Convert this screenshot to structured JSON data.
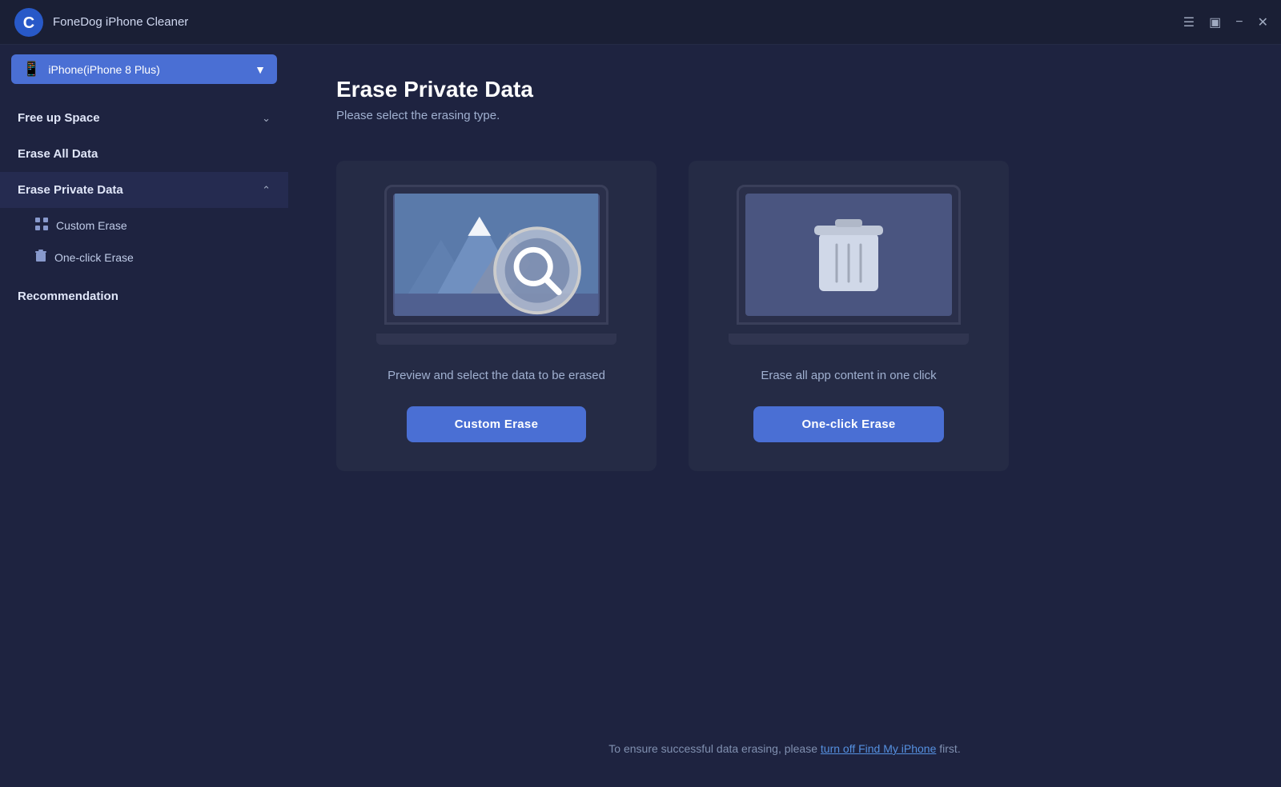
{
  "titlebar": {
    "app_name": "FoneDog iPhone Cleaner",
    "logo_letter": "C"
  },
  "device_selector": {
    "label": "iPhone(iPhone 8 Plus)"
  },
  "sidebar": {
    "menu_items": [
      {
        "id": "free-up-space",
        "label": "Free up Space",
        "has_arrow": true,
        "expanded": false
      },
      {
        "id": "erase-all-data",
        "label": "Erase All Data",
        "has_arrow": false
      },
      {
        "id": "erase-private-data",
        "label": "Erase Private Data",
        "has_arrow": true,
        "expanded": true
      },
      {
        "id": "recommendation",
        "label": "Recommendation",
        "has_arrow": false
      }
    ],
    "sub_items": [
      {
        "id": "custom-erase",
        "label": "Custom Erase",
        "icon": "grid"
      },
      {
        "id": "one-click-erase",
        "label": "One-click Erase",
        "icon": "trash"
      }
    ]
  },
  "main": {
    "page_title": "Erase Private Data",
    "page_subtitle": "Please select the erasing type.",
    "cards": [
      {
        "id": "custom-erase",
        "description": "Preview and select the data to be erased",
        "button_label": "Custom Erase"
      },
      {
        "id": "one-click-erase",
        "description": "Erase all app content in one click",
        "button_label": "One-click Erase"
      }
    ],
    "footer_text_before": "To ensure successful data erasing, please ",
    "footer_link_text": "turn off Find My iPhone",
    "footer_text_after": " first."
  }
}
